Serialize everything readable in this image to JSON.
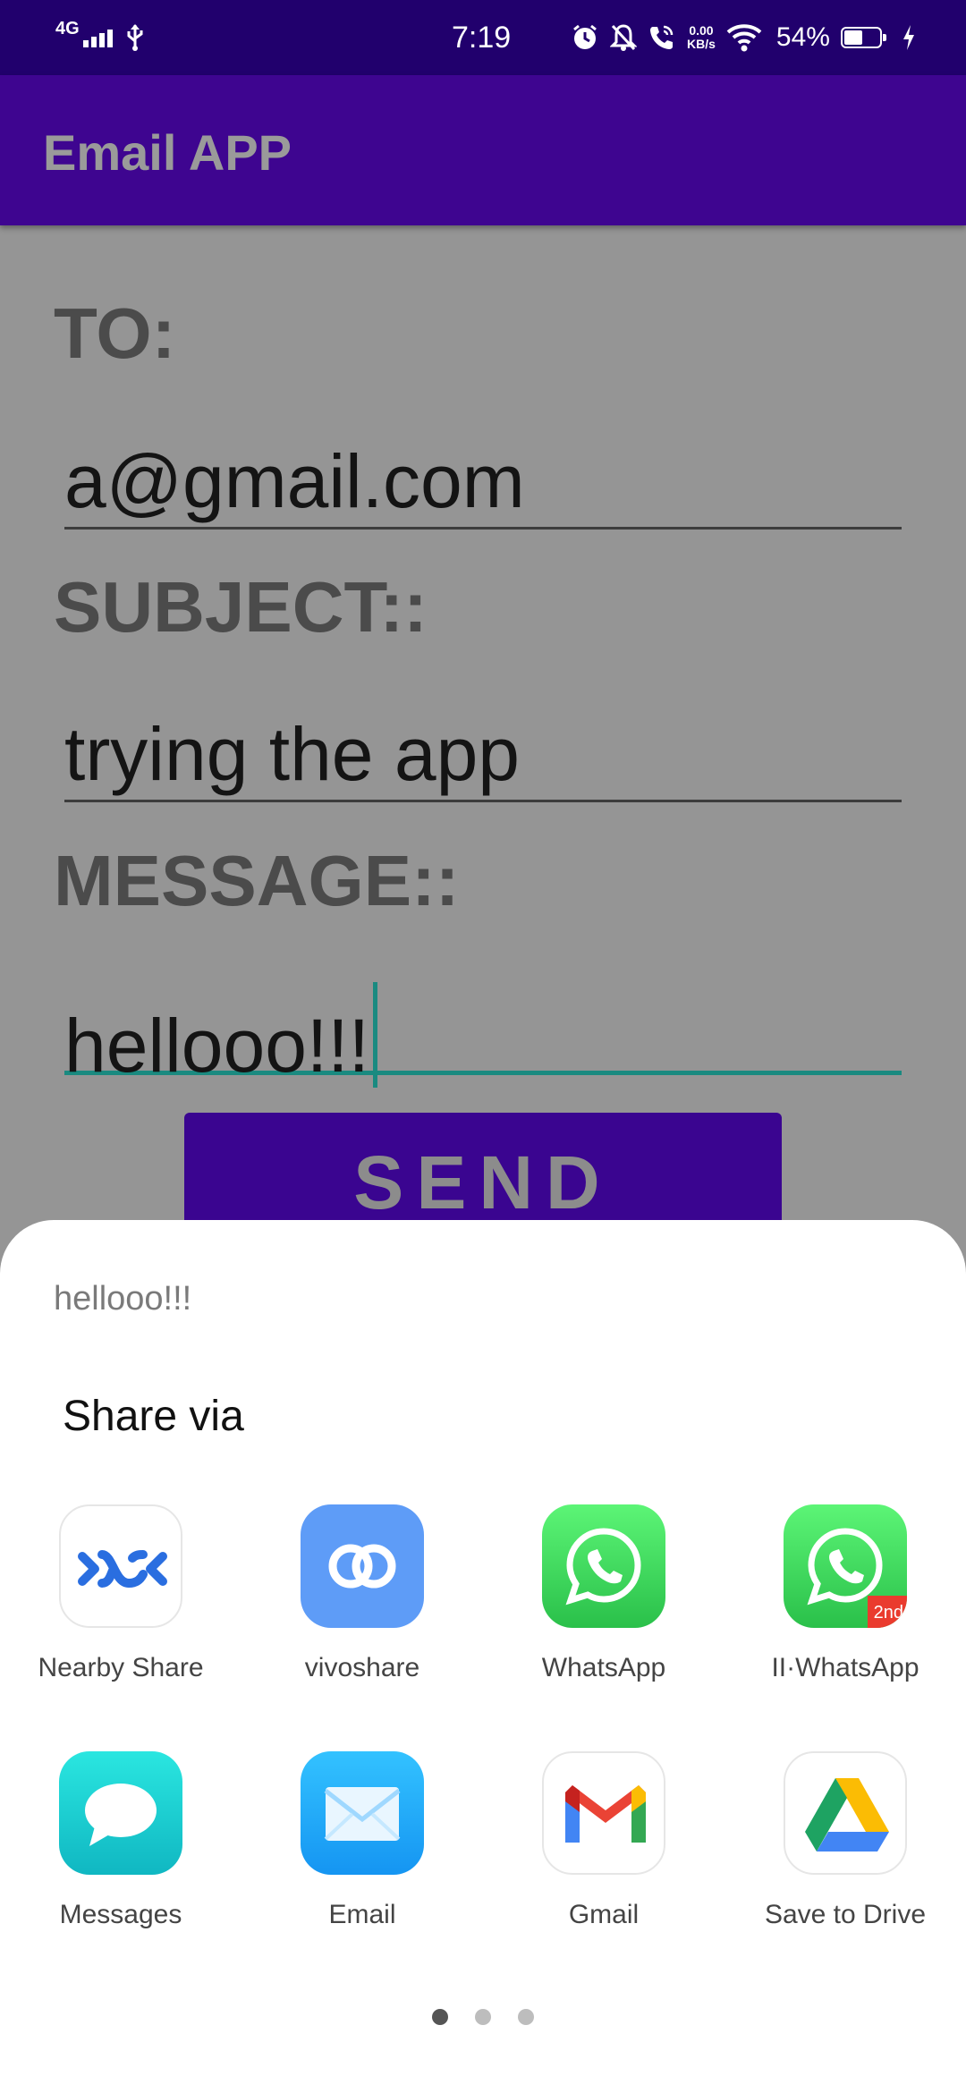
{
  "status_bar": {
    "network": "4G",
    "time": "7:19",
    "speed_value": "0.00",
    "speed_unit": "KB/s",
    "battery_percent": "54%",
    "battery_level": 0.54,
    "icons": [
      "signal-icon",
      "usb-icon",
      "alarm-icon",
      "bell-off-icon",
      "wifi-calling-icon",
      "wifi-icon",
      "battery-icon",
      "charging-icon"
    ]
  },
  "app_bar": {
    "title": "Email APP"
  },
  "form": {
    "to_label": "TO:",
    "to_value": "a@gmail.com",
    "subject_label": "SUBJECT::",
    "subject_value": "trying the app",
    "message_label": "MESSAGE::",
    "message_value": "hellooo!!!",
    "send_label": "SEND"
  },
  "share_sheet": {
    "preview_text": "hellooo!!!",
    "title": "Share via",
    "apps": [
      {
        "label": "Nearby Share",
        "icon": "nearby-share-icon"
      },
      {
        "label": "vivoshare",
        "icon": "vivoshare-icon"
      },
      {
        "label": "WhatsApp",
        "icon": "whatsapp-icon"
      },
      {
        "label": "II·WhatsApp",
        "icon": "whatsapp-clone-icon",
        "badge": "2nd"
      },
      {
        "label": "Messages",
        "icon": "messages-icon"
      },
      {
        "label": "Email",
        "icon": "email-icon"
      },
      {
        "label": "Gmail",
        "icon": "gmail-icon"
      },
      {
        "label": "Save to Drive",
        "icon": "google-drive-icon"
      }
    ],
    "pages": 3,
    "current_page": 1
  },
  "colors": {
    "status_bar": "#21006d",
    "app_bar": "#3e0590",
    "scrim_background": "#959595",
    "focus_accent": "#1a8a80",
    "whatsapp_green": "#2ecf56",
    "vivoshare_blue": "#5e9cf7"
  }
}
